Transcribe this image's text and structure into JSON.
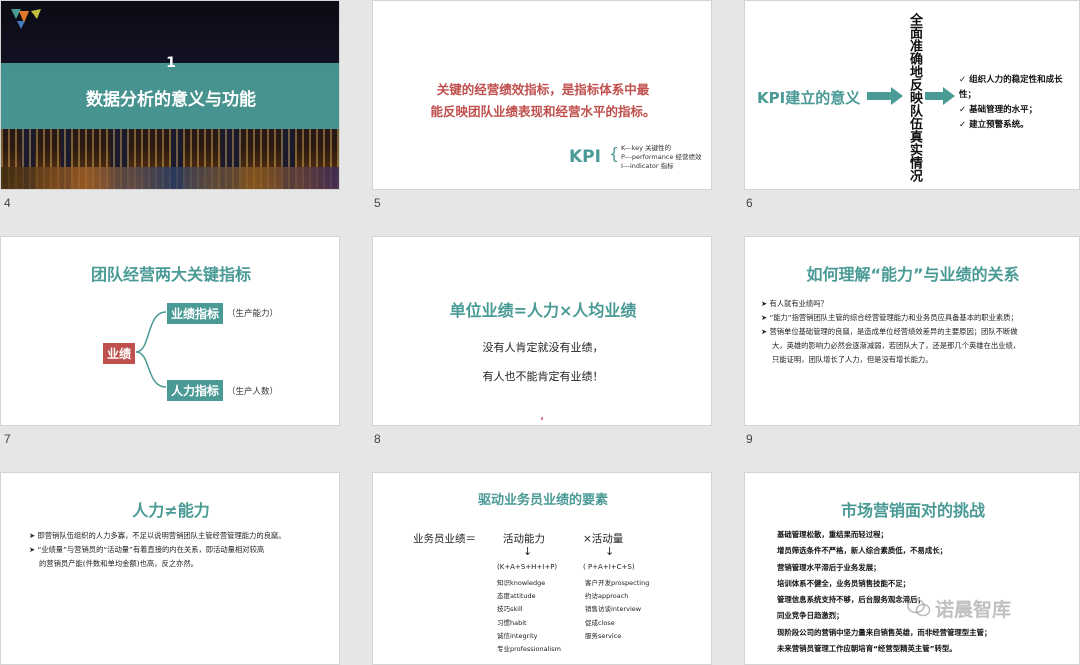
{
  "slides": {
    "s4": {
      "num_label": "4",
      "number": "1",
      "title": "数据分析的意义与功能"
    },
    "s5": {
      "num_label": "5",
      "line1": "关键的经营绩效指标，是指标体系中最",
      "line2": "能反映团队业绩表现和经营水平的指标。",
      "kpi": "KPI",
      "k": "K---key 关键性的",
      "p": "P---performance 经营绩效",
      "i": "I---indicator 指标"
    },
    "s6": {
      "num_label": "6",
      "left": "KPI建立的意义",
      "vertical": "全面准确地反映队伍真实情况",
      "items": [
        "组织人力的稳定性和成长性；",
        "基础管理的水平；",
        "建立预警系统。"
      ]
    },
    "s7": {
      "num_label": "7",
      "title": "团队经营两大关键指标",
      "root": "业绩",
      "b1": "业绩指标",
      "b1note": "（生产能力）",
      "b2": "人力指标",
      "b2note": "（生产人数）"
    },
    "s8": {
      "num_label": "8",
      "title": "单位业绩=人力×人均业绩",
      "l1": "没有人肯定就没有业绩，",
      "l2": "有人也不能肯定有业绩！"
    },
    "s9": {
      "num_label": "9",
      "title": "如何理解“能力”与业绩的关系",
      "b1": "有人就有业绩吗？",
      "b2": "“能力”指营销团队主管的综合经营管理能力和业务员应具备基本的职业素质；",
      "b3a": "营销单位基础管理的良窳，是造成单位经营绩效差异的主要原因；团队不断做",
      "b3b": "大，英雄的影响力必然会逐渐减弱，若团队大了，还是那几个英雄在出业绩，",
      "b3c": "只能证明，团队增长了人力，但是没有增长能力。"
    },
    "s10": {
      "title": "人力≠能力",
      "b1": "即营销队伍组织的人力多寡，不足以说明营销团队主管经营管理能力的良窳。",
      "b2a": "“业绩量”与营销员的“活动量”有着直接的内在关系，即活动量相对较高",
      "b2b": "的营销员产能(件数和单均金额)也高，反之亦然。"
    },
    "s11": {
      "title": "驱动业务员业绩的要素",
      "lhs": "业务员业绩＝",
      "a1": "活动能力",
      "a2": "×活动量",
      "f1": "(K+A+S+H+I+P)",
      "f2": "( P+A+I+C+S)",
      "left_items": [
        "知识knowledge",
        "态度attitude",
        "技巧skill",
        "习惯habit",
        "诚信integrity",
        "专业professionalism"
      ],
      "right_items": [
        "客户开发prospecting",
        "约访approach",
        "销售访谈interview",
        "促成close",
        "服务service"
      ]
    },
    "s12": {
      "title": "市场营销面对的挑战",
      "items": [
        "基础管理松散，重结果而轻过程；",
        "增员筛选条件不严格，新人综合素质低，不易成长；",
        "营销管理水平滞后于业务发展；",
        "培训体系不健全，业务员销售技能不足；",
        "管理信息系统支持不够，后台服务观念滞后；",
        "同业竞争日趋激烈；",
        "现阶段公司的营销中坚力量来自销售英雄，而非经营管理型主管；",
        "未来营销员管理工作应朝培育“经营型精英主管”转型。"
      ],
      "watermark": "诺晨智库"
    }
  },
  "colors": {
    "teal": "#4a9a96",
    "red": "#c0504d"
  }
}
